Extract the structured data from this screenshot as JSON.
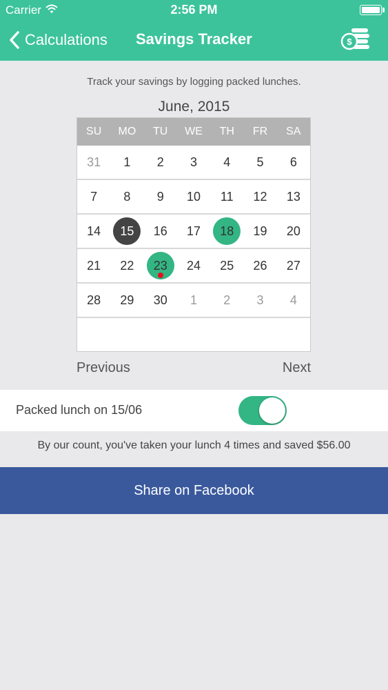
{
  "status_bar": {
    "carrier": "Carrier",
    "time": "2:56 PM"
  },
  "nav": {
    "back_label": "Calculations",
    "title": "Savings Tracker",
    "right_icon": "coins-icon"
  },
  "intro": "Track your savings by logging packed lunches.",
  "calendar": {
    "month": "June, 2015",
    "weekdays": [
      "SU",
      "MO",
      "TU",
      "WE",
      "TH",
      "FR",
      "SA"
    ],
    "weeks": [
      [
        {
          "d": "31",
          "muted": true
        },
        {
          "d": "1"
        },
        {
          "d": "2"
        },
        {
          "d": "3"
        },
        {
          "d": "4"
        },
        {
          "d": "5"
        },
        {
          "d": "6"
        }
      ],
      [
        {
          "d": "7"
        },
        {
          "d": "8"
        },
        {
          "d": "9"
        },
        {
          "d": "10"
        },
        {
          "d": "11"
        },
        {
          "d": "12"
        },
        {
          "d": "13"
        }
      ],
      [
        {
          "d": "14"
        },
        {
          "d": "15",
          "today": true
        },
        {
          "d": "16"
        },
        {
          "d": "17"
        },
        {
          "d": "18",
          "logged": true
        },
        {
          "d": "19"
        },
        {
          "d": "20"
        }
      ],
      [
        {
          "d": "21"
        },
        {
          "d": "22"
        },
        {
          "d": "23",
          "logged": true,
          "dot": true
        },
        {
          "d": "24"
        },
        {
          "d": "25"
        },
        {
          "d": "26"
        },
        {
          "d": "27"
        }
      ],
      [
        {
          "d": "28"
        },
        {
          "d": "29"
        },
        {
          "d": "30"
        },
        {
          "d": "1",
          "muted": true
        },
        {
          "d": "2",
          "muted": true
        },
        {
          "d": "3",
          "muted": true
        },
        {
          "d": "4",
          "muted": true
        }
      ]
    ],
    "previous_label": "Previous",
    "next_label": "Next"
  },
  "toggle": {
    "label": "Packed lunch on 15/06",
    "on": true
  },
  "summary": "By our count, you've taken your lunch 4 times and saved $56.00",
  "facebook_label": "Share on Facebook",
  "colors": {
    "header": "#3cc39b",
    "logged": "#33b584",
    "today": "#444444",
    "facebook": "#3a599d",
    "dot": "#e4111b"
  }
}
